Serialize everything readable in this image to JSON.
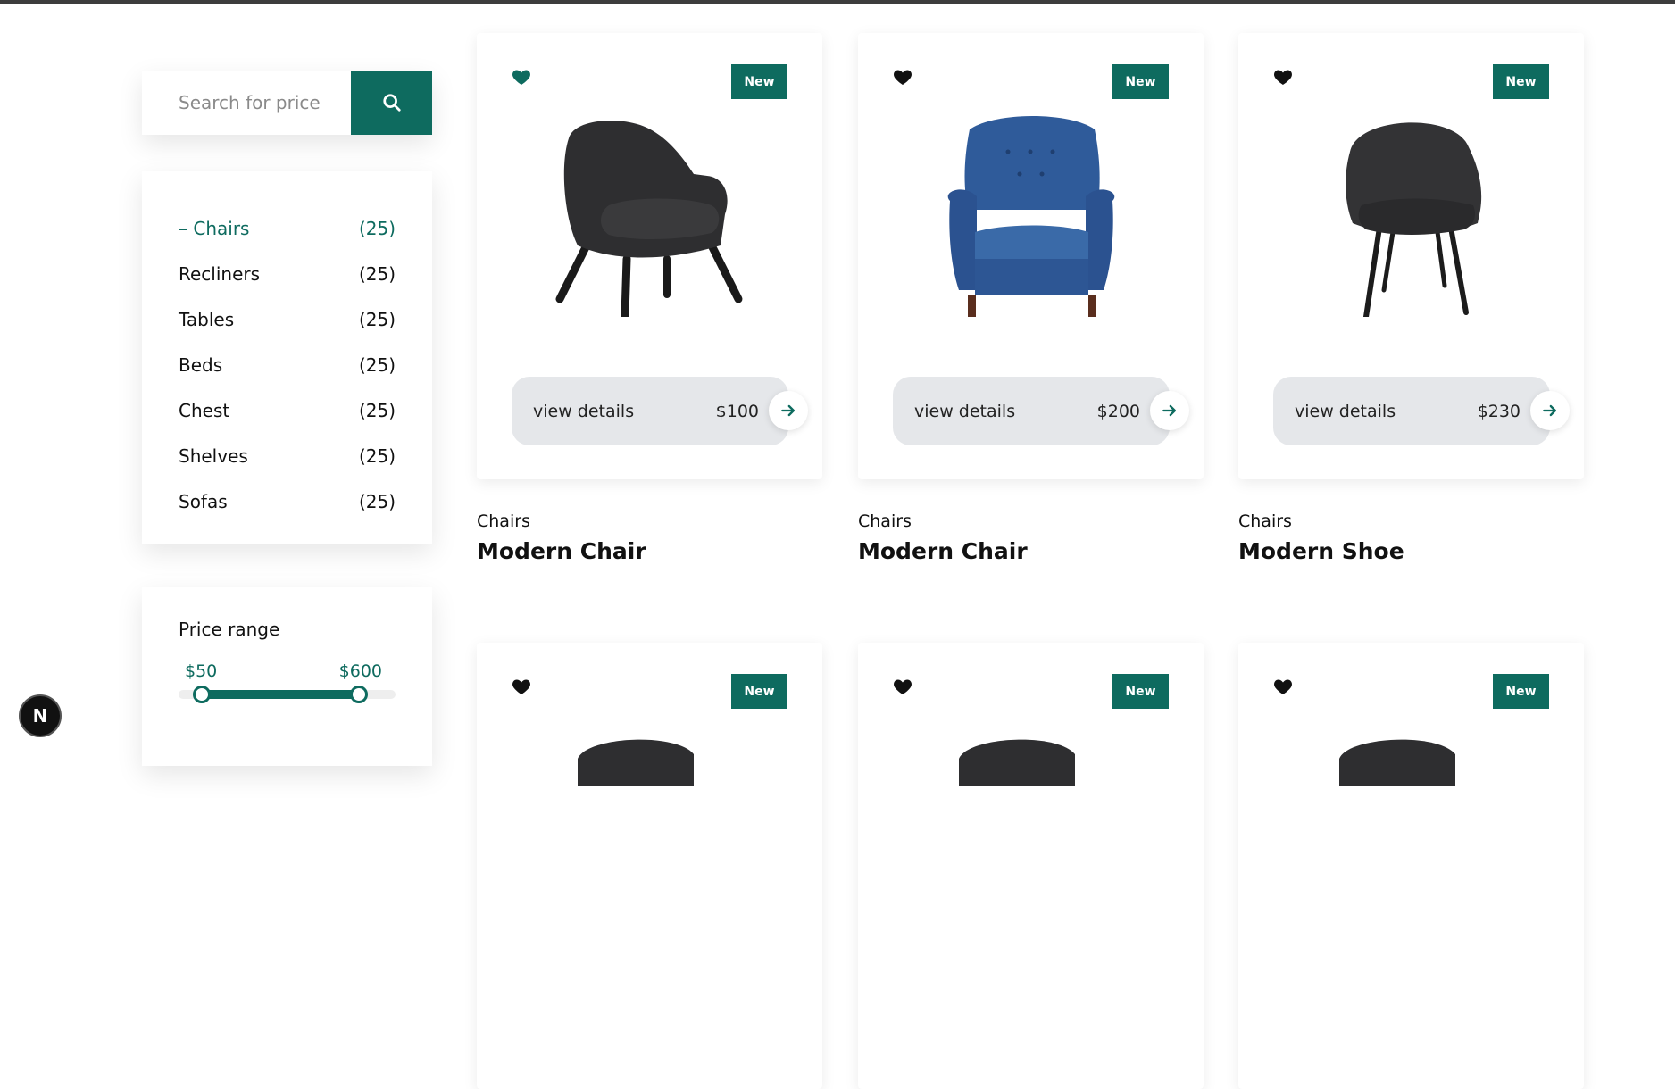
{
  "search": {
    "placeholder": "Search for price"
  },
  "categories": [
    {
      "name": "Chairs",
      "count": "(25)",
      "active": true
    },
    {
      "name": "Recliners",
      "count": "(25)"
    },
    {
      "name": "Tables",
      "count": "(25)"
    },
    {
      "name": "Beds",
      "count": "(25)"
    },
    {
      "name": "Chest",
      "count": "(25)"
    },
    {
      "name": "Shelves",
      "count": "(25)"
    },
    {
      "name": "Sofas",
      "count": "(25)"
    }
  ],
  "price_range": {
    "title": "Price range",
    "min_label": "$50",
    "max_label": "$600"
  },
  "products": [
    {
      "badge": "New",
      "details_label": "view details",
      "price": "$100",
      "category": "Chairs",
      "name": "Modern Chair",
      "favorited": true,
      "image": "grey-lounge-chair"
    },
    {
      "badge": "New",
      "details_label": "view details",
      "price": "$200",
      "category": "Chairs",
      "name": "Modern Chair",
      "favorited": false,
      "image": "blue-wingback-armchair"
    },
    {
      "badge": "New",
      "details_label": "view details",
      "price": "$230",
      "category": "Chairs",
      "name": "Modern Shoe",
      "favorited": false,
      "image": "grey-dining-chair"
    },
    {
      "badge": "New",
      "favorited": false
    },
    {
      "badge": "New",
      "favorited": false
    },
    {
      "badge": "New",
      "favorited": false
    }
  ],
  "dev_badge": {
    "label": "N"
  },
  "colors": {
    "accent": "#0e6b5f",
    "details_bg": "#e5e7ea"
  }
}
